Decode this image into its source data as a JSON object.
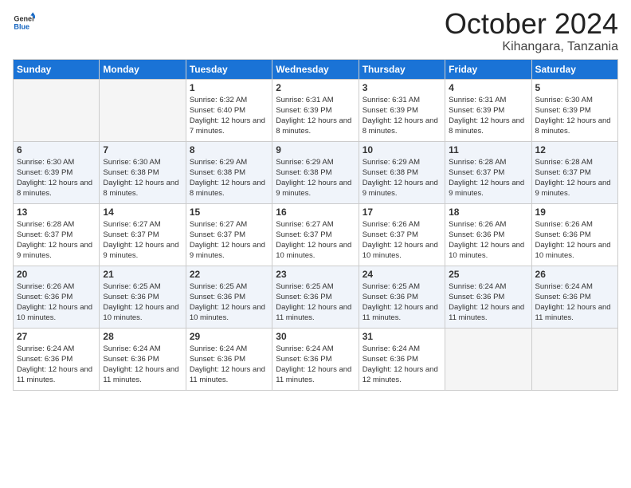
{
  "logo": {
    "line1": "General",
    "line2": "Blue"
  },
  "title": "October 2024",
  "subtitle": "Kihangara, Tanzania",
  "days_of_week": [
    "Sunday",
    "Monday",
    "Tuesday",
    "Wednesday",
    "Thursday",
    "Friday",
    "Saturday"
  ],
  "weeks": [
    [
      {
        "day": "",
        "empty": true
      },
      {
        "day": "",
        "empty": true
      },
      {
        "day": "1",
        "sunrise": "Sunrise: 6:32 AM",
        "sunset": "Sunset: 6:40 PM",
        "daylight": "Daylight: 12 hours and 7 minutes."
      },
      {
        "day": "2",
        "sunrise": "Sunrise: 6:31 AM",
        "sunset": "Sunset: 6:39 PM",
        "daylight": "Daylight: 12 hours and 8 minutes."
      },
      {
        "day": "3",
        "sunrise": "Sunrise: 6:31 AM",
        "sunset": "Sunset: 6:39 PM",
        "daylight": "Daylight: 12 hours and 8 minutes."
      },
      {
        "day": "4",
        "sunrise": "Sunrise: 6:31 AM",
        "sunset": "Sunset: 6:39 PM",
        "daylight": "Daylight: 12 hours and 8 minutes."
      },
      {
        "day": "5",
        "sunrise": "Sunrise: 6:30 AM",
        "sunset": "Sunset: 6:39 PM",
        "daylight": "Daylight: 12 hours and 8 minutes."
      }
    ],
    [
      {
        "day": "6",
        "sunrise": "Sunrise: 6:30 AM",
        "sunset": "Sunset: 6:39 PM",
        "daylight": "Daylight: 12 hours and 8 minutes."
      },
      {
        "day": "7",
        "sunrise": "Sunrise: 6:30 AM",
        "sunset": "Sunset: 6:38 PM",
        "daylight": "Daylight: 12 hours and 8 minutes."
      },
      {
        "day": "8",
        "sunrise": "Sunrise: 6:29 AM",
        "sunset": "Sunset: 6:38 PM",
        "daylight": "Daylight: 12 hours and 8 minutes."
      },
      {
        "day": "9",
        "sunrise": "Sunrise: 6:29 AM",
        "sunset": "Sunset: 6:38 PM",
        "daylight": "Daylight: 12 hours and 9 minutes."
      },
      {
        "day": "10",
        "sunrise": "Sunrise: 6:29 AM",
        "sunset": "Sunset: 6:38 PM",
        "daylight": "Daylight: 12 hours and 9 minutes."
      },
      {
        "day": "11",
        "sunrise": "Sunrise: 6:28 AM",
        "sunset": "Sunset: 6:37 PM",
        "daylight": "Daylight: 12 hours and 9 minutes."
      },
      {
        "day": "12",
        "sunrise": "Sunrise: 6:28 AM",
        "sunset": "Sunset: 6:37 PM",
        "daylight": "Daylight: 12 hours and 9 minutes."
      }
    ],
    [
      {
        "day": "13",
        "sunrise": "Sunrise: 6:28 AM",
        "sunset": "Sunset: 6:37 PM",
        "daylight": "Daylight: 12 hours and 9 minutes."
      },
      {
        "day": "14",
        "sunrise": "Sunrise: 6:27 AM",
        "sunset": "Sunset: 6:37 PM",
        "daylight": "Daylight: 12 hours and 9 minutes."
      },
      {
        "day": "15",
        "sunrise": "Sunrise: 6:27 AM",
        "sunset": "Sunset: 6:37 PM",
        "daylight": "Daylight: 12 hours and 9 minutes."
      },
      {
        "day": "16",
        "sunrise": "Sunrise: 6:27 AM",
        "sunset": "Sunset: 6:37 PM",
        "daylight": "Daylight: 12 hours and 10 minutes."
      },
      {
        "day": "17",
        "sunrise": "Sunrise: 6:26 AM",
        "sunset": "Sunset: 6:37 PM",
        "daylight": "Daylight: 12 hours and 10 minutes."
      },
      {
        "day": "18",
        "sunrise": "Sunrise: 6:26 AM",
        "sunset": "Sunset: 6:36 PM",
        "daylight": "Daylight: 12 hours and 10 minutes."
      },
      {
        "day": "19",
        "sunrise": "Sunrise: 6:26 AM",
        "sunset": "Sunset: 6:36 PM",
        "daylight": "Daylight: 12 hours and 10 minutes."
      }
    ],
    [
      {
        "day": "20",
        "sunrise": "Sunrise: 6:26 AM",
        "sunset": "Sunset: 6:36 PM",
        "daylight": "Daylight: 12 hours and 10 minutes."
      },
      {
        "day": "21",
        "sunrise": "Sunrise: 6:25 AM",
        "sunset": "Sunset: 6:36 PM",
        "daylight": "Daylight: 12 hours and 10 minutes."
      },
      {
        "day": "22",
        "sunrise": "Sunrise: 6:25 AM",
        "sunset": "Sunset: 6:36 PM",
        "daylight": "Daylight: 12 hours and 10 minutes."
      },
      {
        "day": "23",
        "sunrise": "Sunrise: 6:25 AM",
        "sunset": "Sunset: 6:36 PM",
        "daylight": "Daylight: 12 hours and 11 minutes."
      },
      {
        "day": "24",
        "sunrise": "Sunrise: 6:25 AM",
        "sunset": "Sunset: 6:36 PM",
        "daylight": "Daylight: 12 hours and 11 minutes."
      },
      {
        "day": "25",
        "sunrise": "Sunrise: 6:24 AM",
        "sunset": "Sunset: 6:36 PM",
        "daylight": "Daylight: 12 hours and 11 minutes."
      },
      {
        "day": "26",
        "sunrise": "Sunrise: 6:24 AM",
        "sunset": "Sunset: 6:36 PM",
        "daylight": "Daylight: 12 hours and 11 minutes."
      }
    ],
    [
      {
        "day": "27",
        "sunrise": "Sunrise: 6:24 AM",
        "sunset": "Sunset: 6:36 PM",
        "daylight": "Daylight: 12 hours and 11 minutes."
      },
      {
        "day": "28",
        "sunrise": "Sunrise: 6:24 AM",
        "sunset": "Sunset: 6:36 PM",
        "daylight": "Daylight: 12 hours and 11 minutes."
      },
      {
        "day": "29",
        "sunrise": "Sunrise: 6:24 AM",
        "sunset": "Sunset: 6:36 PM",
        "daylight": "Daylight: 12 hours and 11 minutes."
      },
      {
        "day": "30",
        "sunrise": "Sunrise: 6:24 AM",
        "sunset": "Sunset: 6:36 PM",
        "daylight": "Daylight: 12 hours and 11 minutes."
      },
      {
        "day": "31",
        "sunrise": "Sunrise: 6:24 AM",
        "sunset": "Sunset: 6:36 PM",
        "daylight": "Daylight: 12 hours and 12 minutes."
      },
      {
        "day": "",
        "empty": true
      },
      {
        "day": "",
        "empty": true
      }
    ]
  ]
}
